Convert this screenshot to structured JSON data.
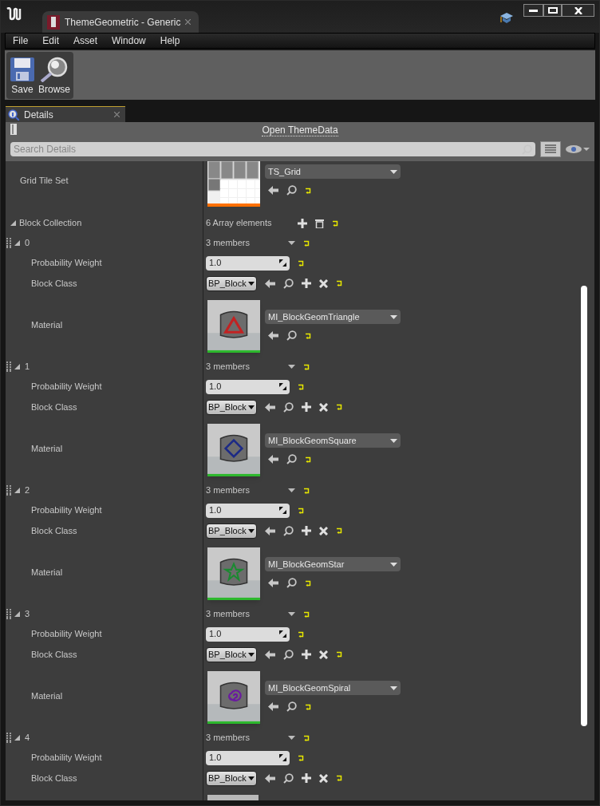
{
  "window": {
    "tab_title": "ThemeGeometric - Generic"
  },
  "menu": [
    "File",
    "Edit",
    "Asset",
    "Window",
    "Help"
  ],
  "toolbar": [
    {
      "kind": "save",
      "label": "Save"
    },
    {
      "kind": "browse",
      "label": "Browse"
    }
  ],
  "panel_tab": {
    "label": "Details"
  },
  "details": {
    "open_link": "Open ThemeData",
    "search": {
      "placeholder": "Search Details"
    },
    "grid_tile_set": {
      "label": "Grid Tile Set",
      "value": "TS_Grid"
    },
    "collection": {
      "label": "Block Collection",
      "expanded": true,
      "summary": "6 Array elements",
      "elements": [
        {
          "index": "0",
          "expanded": true,
          "summary": "3 members",
          "weight_label": "Probability Weight",
          "weight": "1.0",
          "class_label": "Block Class",
          "block_class": "BP_Block",
          "material": {
            "label": "Material",
            "value": "MI_BlockGeomTriangle",
            "kind": "triangle",
            "color": "#c22222"
          }
        },
        {
          "index": "1",
          "expanded": true,
          "summary": "3 members",
          "weight_label": "Probability Weight",
          "weight": "1.0",
          "class_label": "Block Class",
          "block_class": "BP_Block",
          "material": {
            "label": "Material",
            "value": "MI_BlockGeomSquare",
            "kind": "square",
            "color": "#1c2a86"
          }
        },
        {
          "index": "2",
          "expanded": true,
          "summary": "3 members",
          "weight_label": "Probability Weight",
          "weight": "1.0",
          "class_label": "Block Class",
          "block_class": "BP_Block",
          "material": {
            "label": "Material",
            "value": "MI_BlockGeomStar",
            "kind": "star",
            "color": "#1a8a30"
          }
        },
        {
          "index": "3",
          "expanded": true,
          "summary": "3 members",
          "weight_label": "Probability Weight",
          "weight": "1.0",
          "class_label": "Block Class",
          "block_class": "BP_Block",
          "material": {
            "label": "Material",
            "value": "MI_BlockGeomSpiral",
            "kind": "spiral",
            "color": "#6a1aa0"
          }
        },
        {
          "index": "4",
          "expanded": true,
          "summary": "3 members",
          "weight_label": "Probability Weight",
          "weight": "1.0",
          "class_label": "Block Class",
          "block_class": "BP_Block",
          "material": {
            "kind": "cut"
          }
        }
      ]
    }
  }
}
